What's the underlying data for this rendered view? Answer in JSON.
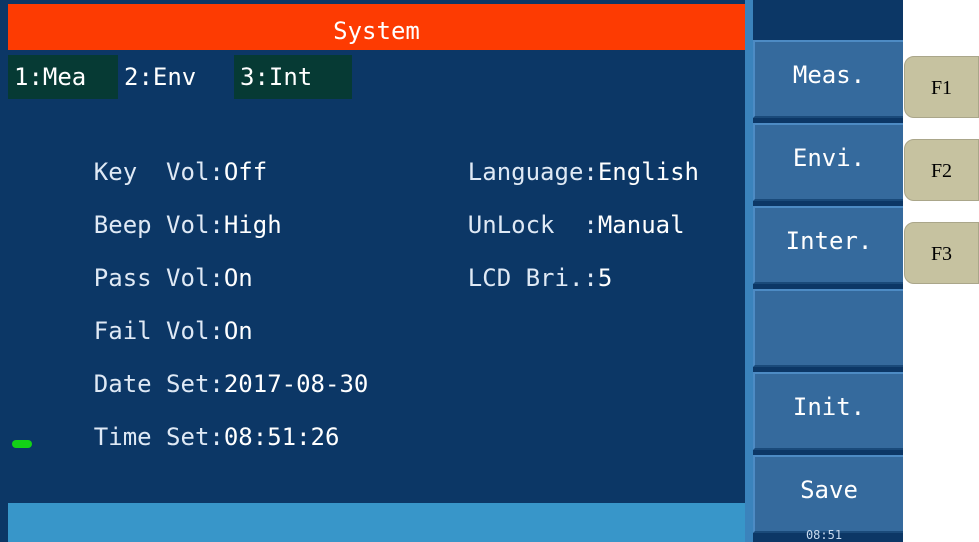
{
  "title": "System",
  "tabs": [
    {
      "label": "1:Mea"
    },
    {
      "label": "2:Env"
    },
    {
      "label": "3:Int"
    }
  ],
  "settings_left": [
    {
      "label": "Key  Vol:",
      "value": "Off"
    },
    {
      "label": "Beep Vol:",
      "value": "High"
    },
    {
      "label": "Pass Vol:",
      "value": "On"
    },
    {
      "label": "Fail Vol:",
      "value": "On"
    },
    {
      "label": "Date Set:",
      "value": "2017-08-30"
    },
    {
      "label": "Time Set:",
      "value": "08:51:26"
    }
  ],
  "settings_right": [
    {
      "label": "Language:",
      "value": "English"
    },
    {
      "label": "UnLock  :",
      "value": "Manual"
    },
    {
      "label": "LCD Bri.:",
      "value": "5"
    }
  ],
  "softkeys": [
    {
      "label": "Meas."
    },
    {
      "label": "Envi."
    },
    {
      "label": "Inter."
    },
    {
      "label": ""
    },
    {
      "label": "Init."
    },
    {
      "label": "Save"
    }
  ],
  "clock": "08:51",
  "function_keys": [
    "F1",
    "F2",
    "F3"
  ],
  "colors": {
    "title_bar": "#fd3b02",
    "screen_bg": "#0c3766",
    "status_bar": "#3896c9",
    "softkey": "#356a9d",
    "fkey": "#c6c2a0"
  }
}
